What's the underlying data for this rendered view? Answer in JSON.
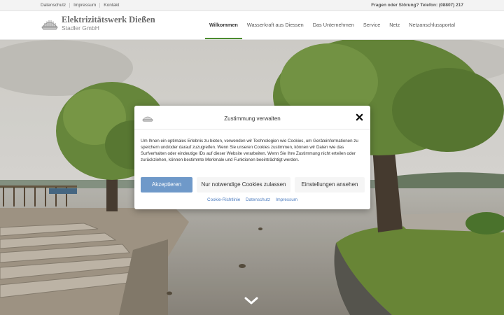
{
  "topbar": {
    "links": [
      "Datenschutz",
      "Impressum",
      "Kontakt"
    ],
    "phone": "Fragen oder Störung? Telefon: (08807) 217"
  },
  "brand": {
    "line1": "Elektrizitätswerk Dießen",
    "line2": "Stadler GmbH"
  },
  "nav": {
    "items": [
      "Wilkommen",
      "Wasserkraft aus Diessen",
      "Das Unternehmen",
      "Service",
      "Netz",
      "Netzanschlussportal"
    ],
    "active_index": 0,
    "active_color": "#4c8c2f"
  },
  "hero": {
    "scroll_icon": "chevron-down-icon"
  },
  "consent": {
    "title": "Zustimmung verwalten",
    "text": "Um Ihnen ein optimales Erlebnis zu bieten, verwenden wir Technologien wie Cookies, um Geräteinformationen zu speichern und/oder darauf zuzugreifen. Wenn Sie unseren Cookies zustimmen, können wir Daten wie das Surfverhalten oder eindeutige IDs auf dieser Website verarbeiten. Wenn Sie Ihre Zustimmung nicht erteilen oder zurückziehen, können bestimmte Merkmale und Funktionen beeinträchtigt werden.",
    "accept": "Akzeptieren",
    "necessary": "Nur notwendige Cookies zulassen",
    "settings": "Einstellungen ansehen",
    "links": [
      "Cookie-Richtlinie",
      "Datenschutz",
      "Impressum"
    ],
    "accept_color": "#6f99c9",
    "link_color": "#4b7bbf"
  }
}
